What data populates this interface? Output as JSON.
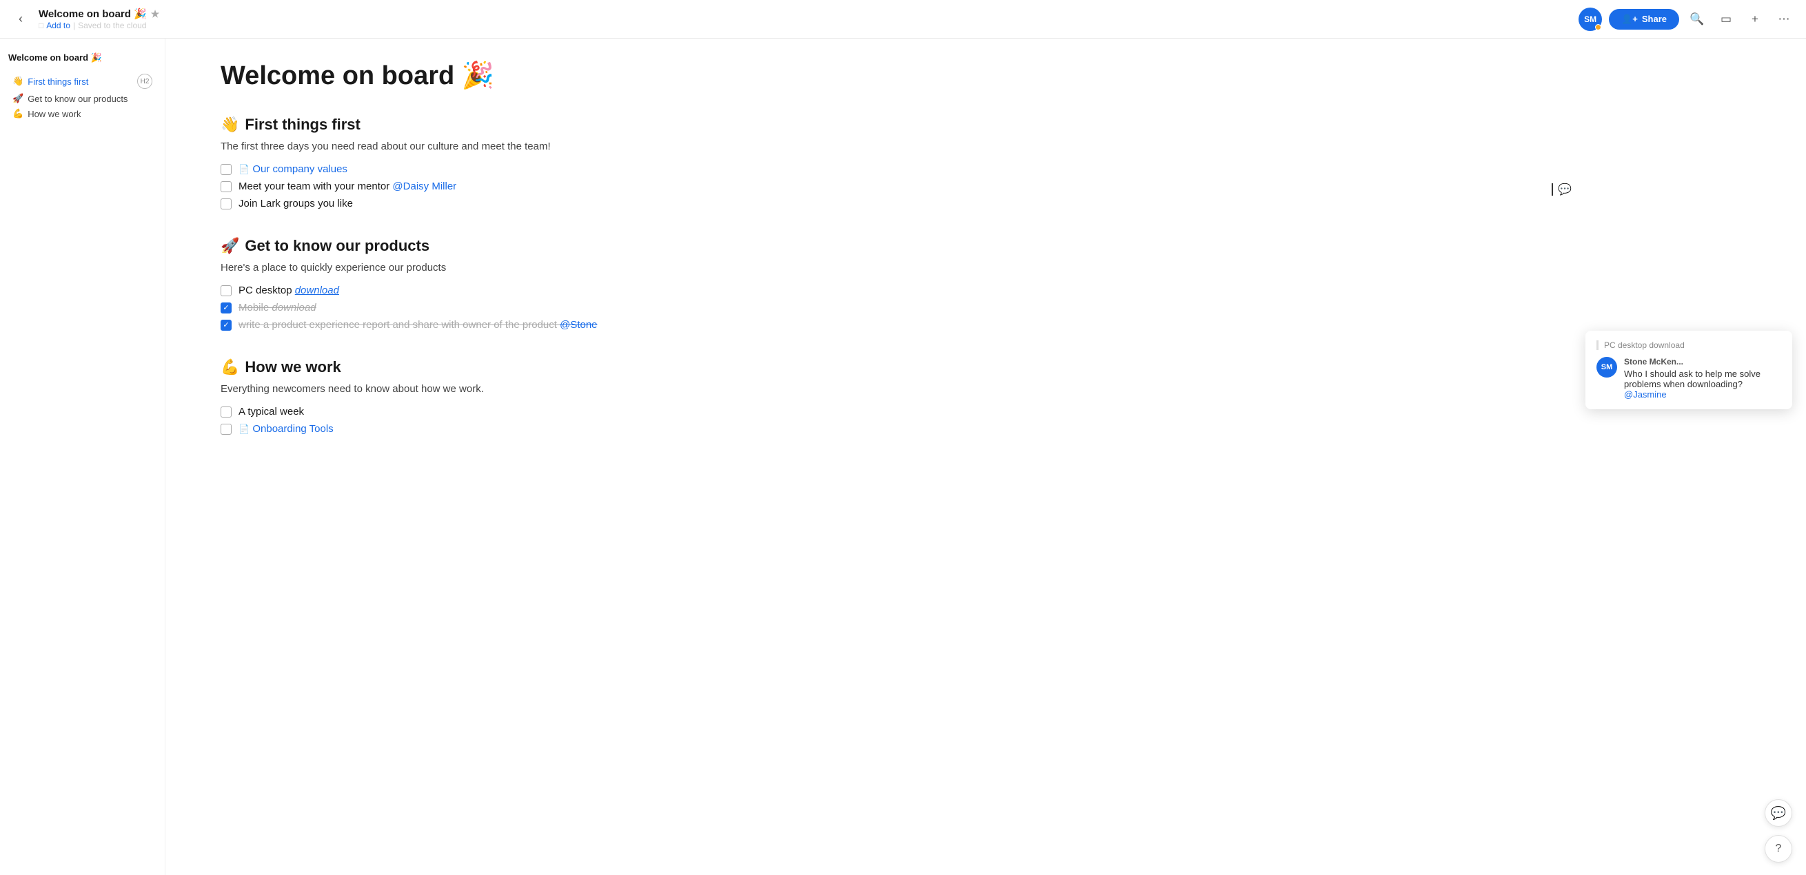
{
  "topbar": {
    "back_icon": "‹",
    "title": "Welcome on board 🎉",
    "star_icon": "★",
    "add_to": "Add to",
    "saved": "Saved to the cloud",
    "avatar_initials": "SM",
    "share_label": "Share",
    "search_icon": "search",
    "present_icon": "present",
    "plus_icon": "+",
    "more_icon": "···"
  },
  "page": {
    "title": "Welcome on board 🎉",
    "sections": [
      {
        "id": "first-things-first",
        "emoji": "👋",
        "heading": "First things first",
        "description": "The first three days you need read about our culture and meet the team!",
        "items": [
          {
            "checked": false,
            "text": "Our company values",
            "link": true,
            "doc_icon": true
          },
          {
            "checked": false,
            "text": "Meet your team with your mentor @Daisy Miller",
            "mention": "@Daisy Miller"
          },
          {
            "checked": false,
            "text": "Join Lark groups you like"
          }
        ]
      },
      {
        "id": "get-to-know",
        "emoji": "🚀",
        "heading": "Get to know our products",
        "description": "Here's a place to quickly experience our products",
        "items": [
          {
            "checked": false,
            "text": "PC desktop ",
            "link_text": "download",
            "strikethrough": false
          },
          {
            "checked": true,
            "text": "Mobile ",
            "link_text": "download",
            "strikethrough": true
          },
          {
            "checked": true,
            "text": "write a product experience report and share with owner of the product @Stone",
            "strikethrough": true
          }
        ]
      },
      {
        "id": "how-we-work",
        "emoji": "💪",
        "heading": "How we work",
        "description": "Everything newcomers need to know about how we work.",
        "items": [
          {
            "checked": false,
            "text": "A typical week"
          },
          {
            "checked": false,
            "text": "Onboarding Tools",
            "link": true,
            "doc_icon": true
          }
        ]
      }
    ]
  },
  "sidebar": {
    "doc_title": "Welcome on board 🎉",
    "items": [
      {
        "emoji": "👋",
        "label": "First things first",
        "active": true
      },
      {
        "emoji": "🚀",
        "label": "Get to know our products",
        "active": false
      },
      {
        "emoji": "💪",
        "label": "How we work",
        "active": false
      }
    ],
    "h2_badge": "H2"
  },
  "comment_popup": {
    "header": "PC desktop download",
    "author": "Stone McKen...",
    "avatar": "SM",
    "message": "Who I should ask to help me solve problems when downloading?",
    "mention": "@Jasmine"
  }
}
